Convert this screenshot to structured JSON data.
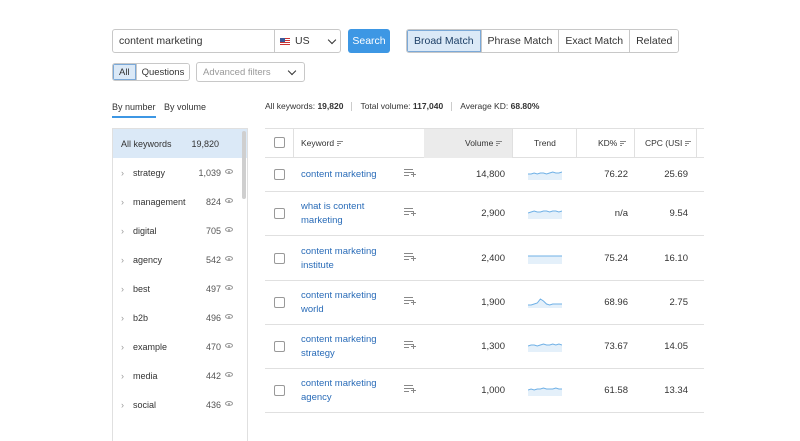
{
  "search": {
    "query": "content marketing",
    "database": "US",
    "button_label": "Search"
  },
  "match_tabs": [
    "Broad Match",
    "Phrase Match",
    "Exact Match",
    "Related"
  ],
  "filters": {
    "scope": [
      "All",
      "Questions"
    ],
    "advanced_placeholder": "Advanced filters"
  },
  "sort_tabs": [
    "By number",
    "By volume"
  ],
  "summary": {
    "keywords_label": "All keywords:",
    "keywords_value": "19,820",
    "volume_label": "Total volume:",
    "volume_value": "117,040",
    "kd_label": "Average KD:",
    "kd_value": "68.80%"
  },
  "sidebar": {
    "all_label": "All keywords",
    "all_count": "19,820",
    "items": [
      {
        "label": "strategy",
        "count": "1,039"
      },
      {
        "label": "management",
        "count": "824"
      },
      {
        "label": "digital",
        "count": "705"
      },
      {
        "label": "agency",
        "count": "542"
      },
      {
        "label": "best",
        "count": "497"
      },
      {
        "label": "b2b",
        "count": "496"
      },
      {
        "label": "example",
        "count": "470"
      },
      {
        "label": "media",
        "count": "442"
      },
      {
        "label": "social",
        "count": "436"
      }
    ]
  },
  "table": {
    "headers": {
      "keyword": "Keyword",
      "volume": "Volume",
      "trend": "Trend",
      "kd": "KD%",
      "cpc": "CPC (USI"
    },
    "rows": [
      {
        "keyword": "content marketing",
        "volume": "14,800",
        "kd": "76.22",
        "cpc": "25.69",
        "trend": [
          6,
          6,
          5,
          6,
          5,
          5,
          6,
          5,
          4,
          5,
          5,
          4
        ]
      },
      {
        "keyword": "what is content marketing",
        "volume": "2,900",
        "kd": "n/a",
        "cpc": "9.54",
        "trend": [
          6,
          5,
          4,
          5,
          5,
          4,
          4,
          5,
          4,
          4,
          5,
          4
        ]
      },
      {
        "keyword": "content marketing institute",
        "volume": "2,400",
        "kd": "75.24",
        "cpc": "16.10",
        "trend": [
          4,
          4,
          4,
          4,
          4,
          4,
          4,
          4,
          4,
          4,
          4,
          4
        ]
      },
      {
        "keyword": "content marketing world",
        "volume": "1,900",
        "kd": "68.96",
        "cpc": "2.75",
        "trend": [
          9,
          9,
          8,
          7,
          3,
          5,
          8,
          9,
          8,
          8,
          8,
          8
        ]
      },
      {
        "keyword": "content marketing strategy",
        "volume": "1,300",
        "kd": "73.67",
        "cpc": "14.05",
        "trend": [
          6,
          5,
          5,
          6,
          5,
          4,
          5,
          5,
          4,
          5,
          4,
          5
        ]
      },
      {
        "keyword": "content marketing agency",
        "volume": "1,000",
        "kd": "61.58",
        "cpc": "13.34",
        "trend": [
          6,
          5,
          6,
          5,
          5,
          4,
          5,
          5,
          5,
          4,
          5,
          5
        ]
      }
    ]
  },
  "colors": {
    "accent": "#3d97e4",
    "link": "#2a6cb8",
    "active_bg": "#dbe9f7",
    "trend_line": "#6fb0e6",
    "trend_fill": "#e4f0fa"
  }
}
